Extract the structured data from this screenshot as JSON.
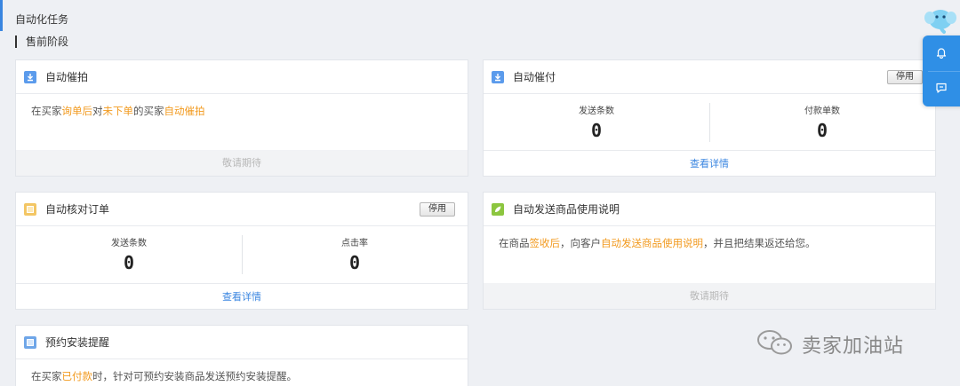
{
  "page": {
    "title": "自动化任务",
    "section": "售前阶段"
  },
  "cards": {
    "auto_urge_order": {
      "title": "自动催拍",
      "desc_parts": [
        "在买家",
        "询单后",
        "对",
        "未下单",
        "的买家",
        "自动催拍"
      ],
      "coming_soon": "敬请期待"
    },
    "auto_urge_pay": {
      "title": "自动催付",
      "stop_label": "停用",
      "stats": [
        {
          "label": "发送条数",
          "value": "0"
        },
        {
          "label": "付款单数",
          "value": "0"
        }
      ],
      "detail_link": "查看详情"
    },
    "auto_check_order": {
      "title": "自动核对订单",
      "stop_label": "停用",
      "stats": [
        {
          "label": "发送条数",
          "value": "0"
        },
        {
          "label": "点击率",
          "value": "0"
        }
      ],
      "detail_link": "查看详情"
    },
    "auto_send_manual": {
      "title": "自动发送商品使用说明",
      "desc_parts": [
        "在商品",
        "签收后",
        "，向客户",
        "自动发送商品使用说明",
        "，并且把结果返还给您。"
      ],
      "coming_soon": "敬请期待"
    },
    "install_reminder": {
      "title": "预约安装提醒",
      "desc_parts": [
        "在买家",
        "已付款",
        "时，针对可预约安装商品发送预约安装提醒。"
      ]
    }
  },
  "float_panel": {
    "icons": [
      "bell-icon",
      "chat-icon"
    ]
  },
  "watermark": {
    "text": "卖家加油站"
  },
  "colors": {
    "accent": "#3a86e0",
    "highlight": "#f29a1f",
    "float_blue": "#2f8fe6"
  }
}
